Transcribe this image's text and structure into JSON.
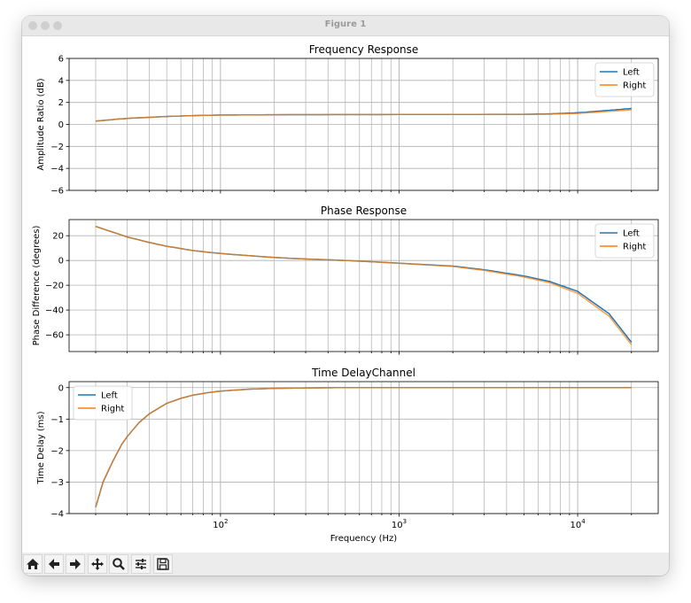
{
  "window": {
    "title": "Figure 1"
  },
  "toolbar": {
    "buttons": [
      "home-icon",
      "back-icon",
      "forward-icon",
      "pan-icon",
      "zoom-icon",
      "configure-subplots-icon",
      "save-icon"
    ]
  },
  "colors": {
    "left": "#1f77b4",
    "right": "#ff7f0e"
  },
  "chart_data": [
    {
      "type": "line",
      "title": "Frequency Response",
      "xlabel": "",
      "ylabel": "Amplitude Ratio (dB)",
      "xscale": "log",
      "xlim": [
        14.2,
        28250
      ],
      "ylim": [
        -6,
        6
      ],
      "yticks": [
        6,
        4,
        2,
        0,
        -2,
        -4,
        -6
      ],
      "ytick_labels": [
        "6",
        "4",
        "2",
        "0",
        "−2",
        "−4",
        "−6"
      ],
      "xtick_labels": [],
      "grid": true,
      "legend": "top-right",
      "x": [
        20,
        30,
        50,
        70,
        100,
        200,
        1000,
        5000,
        7000,
        10000,
        15000,
        20000
      ],
      "series": [
        {
          "name": "Left",
          "values": [
            0.3,
            0.55,
            0.72,
            0.8,
            0.85,
            0.88,
            0.9,
            0.92,
            0.96,
            1.06,
            1.28,
            1.45
          ]
        },
        {
          "name": "Right",
          "values": [
            0.3,
            0.55,
            0.72,
            0.8,
            0.85,
            0.88,
            0.9,
            0.91,
            0.93,
            1.0,
            1.18,
            1.33
          ]
        }
      ]
    },
    {
      "type": "line",
      "title": "Phase Response",
      "xlabel": "",
      "ylabel": "Phase Difference (degrees)",
      "xscale": "log",
      "xlim": [
        14.2,
        28250
      ],
      "ylim": [
        -73.5,
        33
      ],
      "yticks": [
        20,
        0,
        -20,
        -40,
        -60
      ],
      "ytick_labels": [
        "20",
        "0",
        "−20",
        "−40",
        "−60"
      ],
      "xtick_labels": [],
      "grid": true,
      "legend": "top-right",
      "x": [
        20,
        30,
        40,
        50,
        70,
        100,
        200,
        300,
        500,
        700,
        1000,
        2000,
        3000,
        5000,
        7000,
        10000,
        15000,
        20000
      ],
      "series": [
        {
          "name": "Left",
          "values": [
            27.5,
            19,
            14.5,
            11.5,
            8,
            5.6,
            2.4,
            1.2,
            0,
            -1,
            -2.2,
            -4.5,
            -7.5,
            -12.5,
            -17,
            -25,
            -43,
            -66
          ]
        },
        {
          "name": "Right",
          "values": [
            27.5,
            19,
            14.5,
            11.5,
            8,
            5.6,
            2.4,
            1.2,
            0,
            -1,
            -2.3,
            -4.8,
            -8,
            -13.3,
            -18,
            -26.5,
            -45,
            -68
          ]
        }
      ]
    },
    {
      "type": "line",
      "title": "Time DelayChannel",
      "xlabel": "Frequency (Hz)",
      "ylabel": "Time Delay (ms)",
      "xscale": "log",
      "xlim": [
        14.2,
        28250
      ],
      "ylim": [
        -4,
        0.19
      ],
      "yticks": [
        0,
        -1,
        -2,
        -3,
        -4
      ],
      "ytick_labels": [
        "0",
        "−1",
        "−2",
        "−3",
        "−4"
      ],
      "xticks": [
        100,
        1000,
        10000
      ],
      "xtick_labels": [
        "10",
        "10",
        "10"
      ],
      "xtick_exponents": [
        "2",
        "3",
        "4"
      ],
      "grid": true,
      "legend": "top-left",
      "x": [
        20,
        22,
        25,
        28,
        30,
        35,
        40,
        50,
        60,
        70,
        85,
        100,
        150,
        200,
        300,
        500,
        1000,
        20000
      ],
      "series": [
        {
          "name": "Left",
          "values": [
            -3.8,
            -3.0,
            -2.33,
            -1.8,
            -1.56,
            -1.11,
            -0.83,
            -0.5,
            -0.34,
            -0.24,
            -0.16,
            -0.11,
            -0.045,
            -0.024,
            -0.01,
            0,
            0,
            0
          ]
        },
        {
          "name": "Right",
          "values": [
            -3.8,
            -3.0,
            -2.33,
            -1.8,
            -1.56,
            -1.11,
            -0.83,
            -0.5,
            -0.34,
            -0.24,
            -0.16,
            -0.11,
            -0.045,
            -0.024,
            -0.01,
            0,
            0,
            0
          ]
        }
      ]
    }
  ]
}
